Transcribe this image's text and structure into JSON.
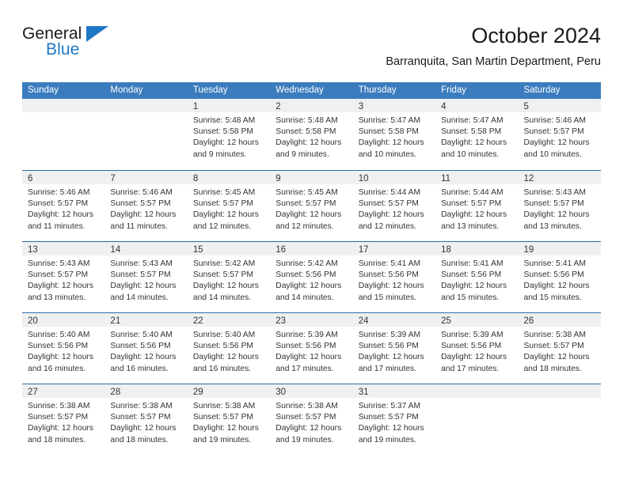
{
  "logo": {
    "word_one": "General",
    "word_two": "Blue",
    "triangle_icon": "blue-triangle-icon",
    "accent_color": "#1f77c4"
  },
  "header": {
    "title": "October 2024",
    "subtitle": "Barranquita, San Martin Department, Peru"
  },
  "theme": {
    "header_blue": "#3b7cbe",
    "row_divider_blue": "#2c6cab",
    "day_band_gray": "#f0f0f0",
    "text_color": "#333333"
  },
  "weekdays": [
    "Sunday",
    "Monday",
    "Tuesday",
    "Wednesday",
    "Thursday",
    "Friday",
    "Saturday"
  ],
  "weeks": [
    [
      {
        "empty": true
      },
      {
        "empty": true
      },
      {
        "day": "1",
        "sunrise": "Sunrise: 5:48 AM",
        "sunset": "Sunset: 5:58 PM",
        "daylight_1": "Daylight: 12 hours",
        "daylight_2": "and 9 minutes."
      },
      {
        "day": "2",
        "sunrise": "Sunrise: 5:48 AM",
        "sunset": "Sunset: 5:58 PM",
        "daylight_1": "Daylight: 12 hours",
        "daylight_2": "and 9 minutes."
      },
      {
        "day": "3",
        "sunrise": "Sunrise: 5:47 AM",
        "sunset": "Sunset: 5:58 PM",
        "daylight_1": "Daylight: 12 hours",
        "daylight_2": "and 10 minutes."
      },
      {
        "day": "4",
        "sunrise": "Sunrise: 5:47 AM",
        "sunset": "Sunset: 5:58 PM",
        "daylight_1": "Daylight: 12 hours",
        "daylight_2": "and 10 minutes."
      },
      {
        "day": "5",
        "sunrise": "Sunrise: 5:46 AM",
        "sunset": "Sunset: 5:57 PM",
        "daylight_1": "Daylight: 12 hours",
        "daylight_2": "and 10 minutes."
      }
    ],
    [
      {
        "day": "6",
        "sunrise": "Sunrise: 5:46 AM",
        "sunset": "Sunset: 5:57 PM",
        "daylight_1": "Daylight: 12 hours",
        "daylight_2": "and 11 minutes."
      },
      {
        "day": "7",
        "sunrise": "Sunrise: 5:46 AM",
        "sunset": "Sunset: 5:57 PM",
        "daylight_1": "Daylight: 12 hours",
        "daylight_2": "and 11 minutes."
      },
      {
        "day": "8",
        "sunrise": "Sunrise: 5:45 AM",
        "sunset": "Sunset: 5:57 PM",
        "daylight_1": "Daylight: 12 hours",
        "daylight_2": "and 12 minutes."
      },
      {
        "day": "9",
        "sunrise": "Sunrise: 5:45 AM",
        "sunset": "Sunset: 5:57 PM",
        "daylight_1": "Daylight: 12 hours",
        "daylight_2": "and 12 minutes."
      },
      {
        "day": "10",
        "sunrise": "Sunrise: 5:44 AM",
        "sunset": "Sunset: 5:57 PM",
        "daylight_1": "Daylight: 12 hours",
        "daylight_2": "and 12 minutes."
      },
      {
        "day": "11",
        "sunrise": "Sunrise: 5:44 AM",
        "sunset": "Sunset: 5:57 PM",
        "daylight_1": "Daylight: 12 hours",
        "daylight_2": "and 13 minutes."
      },
      {
        "day": "12",
        "sunrise": "Sunrise: 5:43 AM",
        "sunset": "Sunset: 5:57 PM",
        "daylight_1": "Daylight: 12 hours",
        "daylight_2": "and 13 minutes."
      }
    ],
    [
      {
        "day": "13",
        "sunrise": "Sunrise: 5:43 AM",
        "sunset": "Sunset: 5:57 PM",
        "daylight_1": "Daylight: 12 hours",
        "daylight_2": "and 13 minutes."
      },
      {
        "day": "14",
        "sunrise": "Sunrise: 5:43 AM",
        "sunset": "Sunset: 5:57 PM",
        "daylight_1": "Daylight: 12 hours",
        "daylight_2": "and 14 minutes."
      },
      {
        "day": "15",
        "sunrise": "Sunrise: 5:42 AM",
        "sunset": "Sunset: 5:57 PM",
        "daylight_1": "Daylight: 12 hours",
        "daylight_2": "and 14 minutes."
      },
      {
        "day": "16",
        "sunrise": "Sunrise: 5:42 AM",
        "sunset": "Sunset: 5:56 PM",
        "daylight_1": "Daylight: 12 hours",
        "daylight_2": "and 14 minutes."
      },
      {
        "day": "17",
        "sunrise": "Sunrise: 5:41 AM",
        "sunset": "Sunset: 5:56 PM",
        "daylight_1": "Daylight: 12 hours",
        "daylight_2": "and 15 minutes."
      },
      {
        "day": "18",
        "sunrise": "Sunrise: 5:41 AM",
        "sunset": "Sunset: 5:56 PM",
        "daylight_1": "Daylight: 12 hours",
        "daylight_2": "and 15 minutes."
      },
      {
        "day": "19",
        "sunrise": "Sunrise: 5:41 AM",
        "sunset": "Sunset: 5:56 PM",
        "daylight_1": "Daylight: 12 hours",
        "daylight_2": "and 15 minutes."
      }
    ],
    [
      {
        "day": "20",
        "sunrise": "Sunrise: 5:40 AM",
        "sunset": "Sunset: 5:56 PM",
        "daylight_1": "Daylight: 12 hours",
        "daylight_2": "and 16 minutes."
      },
      {
        "day": "21",
        "sunrise": "Sunrise: 5:40 AM",
        "sunset": "Sunset: 5:56 PM",
        "daylight_1": "Daylight: 12 hours",
        "daylight_2": "and 16 minutes."
      },
      {
        "day": "22",
        "sunrise": "Sunrise: 5:40 AM",
        "sunset": "Sunset: 5:56 PM",
        "daylight_1": "Daylight: 12 hours",
        "daylight_2": "and 16 minutes."
      },
      {
        "day": "23",
        "sunrise": "Sunrise: 5:39 AM",
        "sunset": "Sunset: 5:56 PM",
        "daylight_1": "Daylight: 12 hours",
        "daylight_2": "and 17 minutes."
      },
      {
        "day": "24",
        "sunrise": "Sunrise: 5:39 AM",
        "sunset": "Sunset: 5:56 PM",
        "daylight_1": "Daylight: 12 hours",
        "daylight_2": "and 17 minutes."
      },
      {
        "day": "25",
        "sunrise": "Sunrise: 5:39 AM",
        "sunset": "Sunset: 5:56 PM",
        "daylight_1": "Daylight: 12 hours",
        "daylight_2": "and 17 minutes."
      },
      {
        "day": "26",
        "sunrise": "Sunrise: 5:38 AM",
        "sunset": "Sunset: 5:57 PM",
        "daylight_1": "Daylight: 12 hours",
        "daylight_2": "and 18 minutes."
      }
    ],
    [
      {
        "day": "27",
        "sunrise": "Sunrise: 5:38 AM",
        "sunset": "Sunset: 5:57 PM",
        "daylight_1": "Daylight: 12 hours",
        "daylight_2": "and 18 minutes."
      },
      {
        "day": "28",
        "sunrise": "Sunrise: 5:38 AM",
        "sunset": "Sunset: 5:57 PM",
        "daylight_1": "Daylight: 12 hours",
        "daylight_2": "and 18 minutes."
      },
      {
        "day": "29",
        "sunrise": "Sunrise: 5:38 AM",
        "sunset": "Sunset: 5:57 PM",
        "daylight_1": "Daylight: 12 hours",
        "daylight_2": "and 19 minutes."
      },
      {
        "day": "30",
        "sunrise": "Sunrise: 5:38 AM",
        "sunset": "Sunset: 5:57 PM",
        "daylight_1": "Daylight: 12 hours",
        "daylight_2": "and 19 minutes."
      },
      {
        "day": "31",
        "sunrise": "Sunrise: 5:37 AM",
        "sunset": "Sunset: 5:57 PM",
        "daylight_1": "Daylight: 12 hours",
        "daylight_2": "and 19 minutes."
      },
      {
        "empty": true
      },
      {
        "empty": true
      }
    ]
  ]
}
